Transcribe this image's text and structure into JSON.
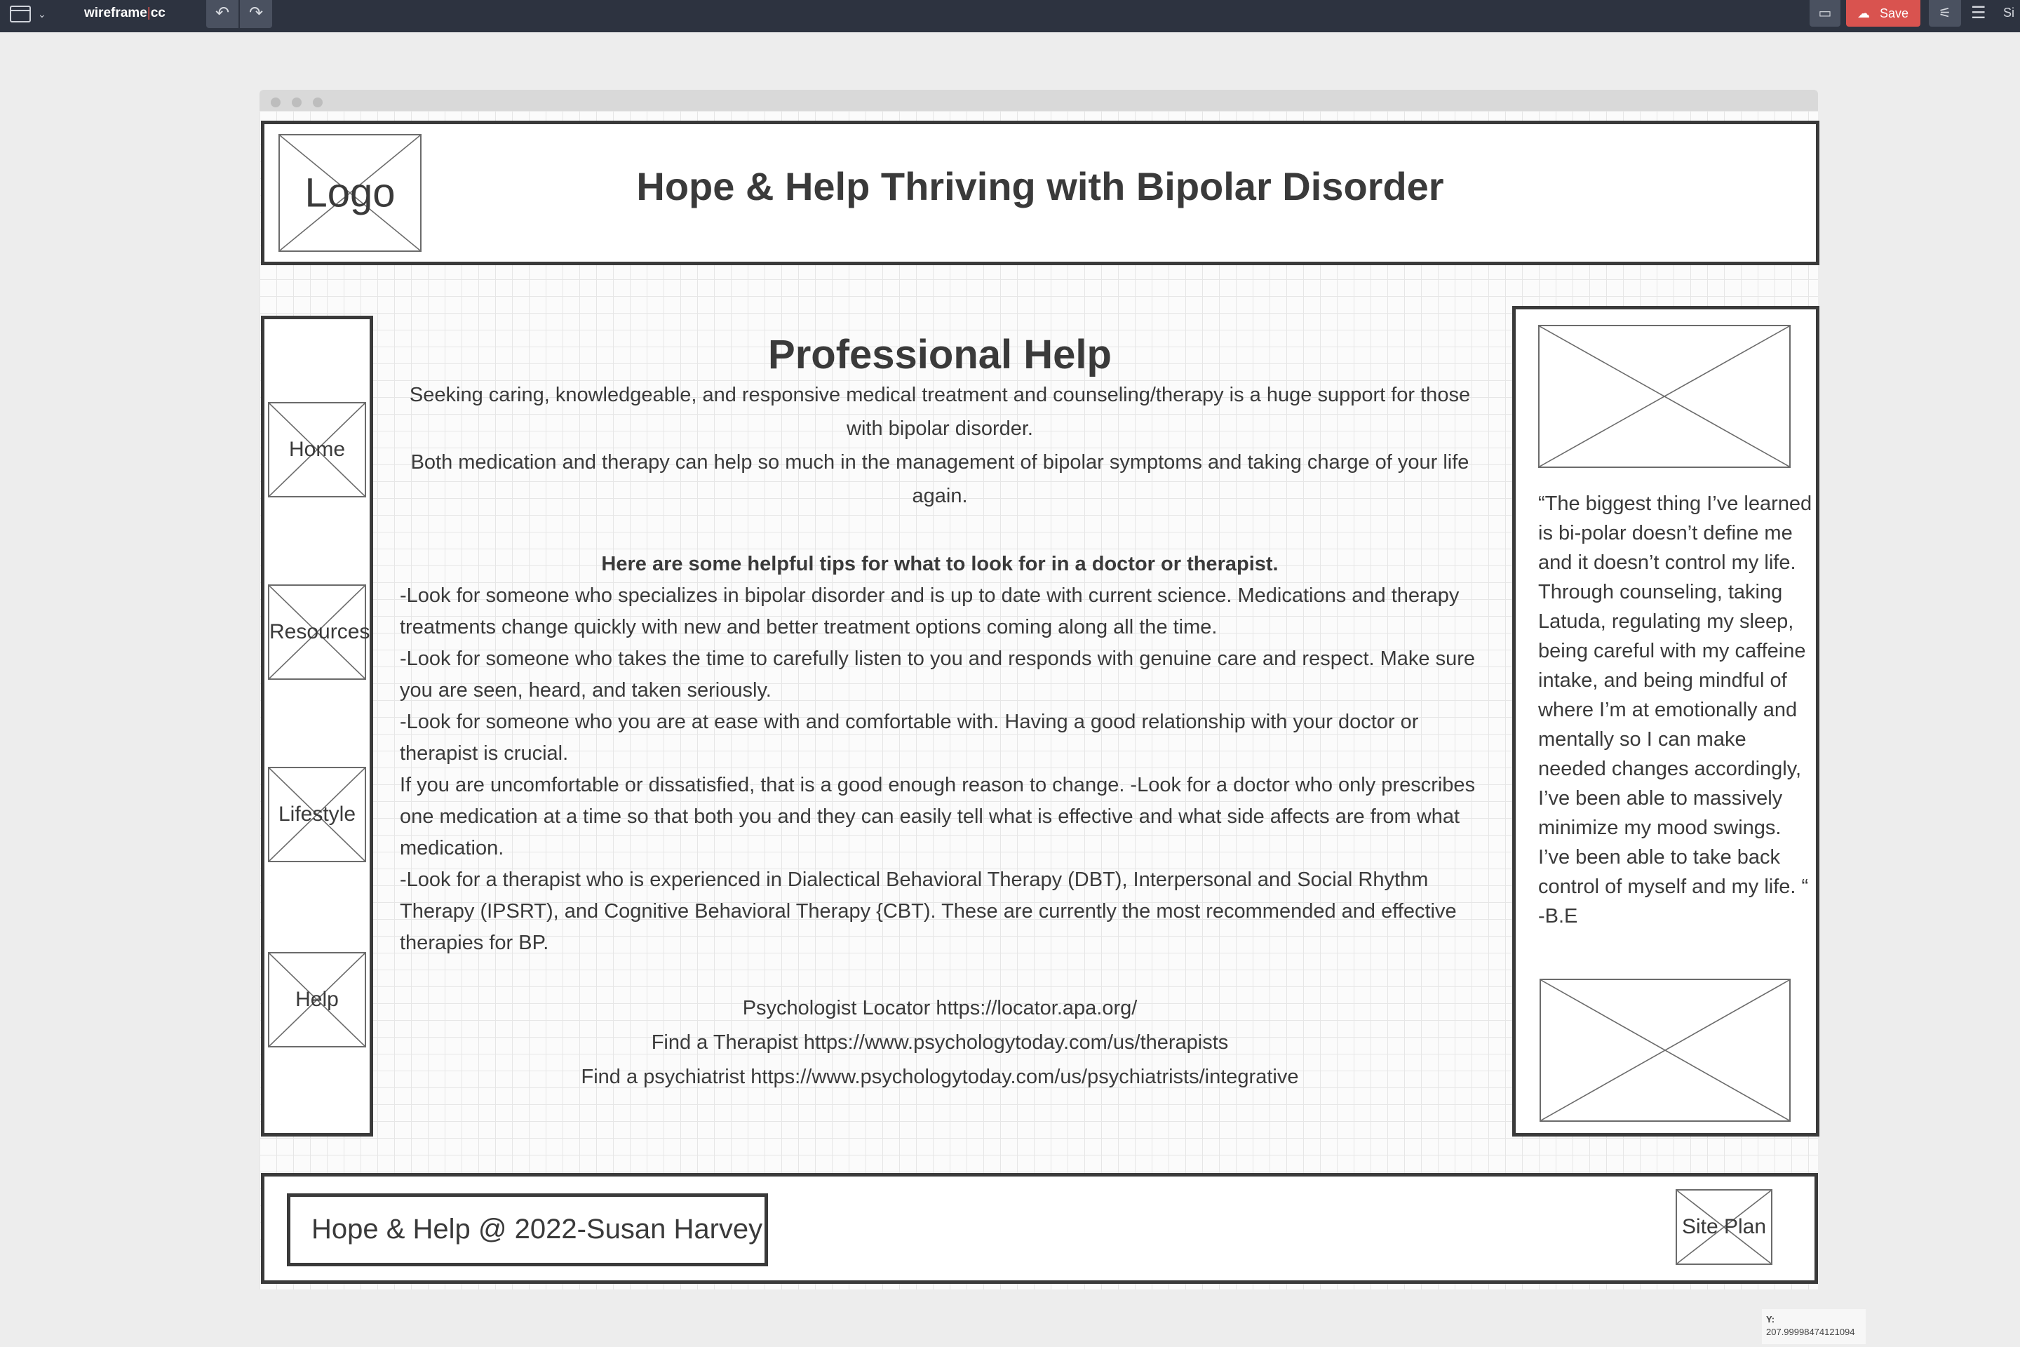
{
  "app": {
    "brand": "wireframe",
    "brand_suffix": "cc",
    "save_label": "Save",
    "side_label": "Si"
  },
  "site": {
    "logo": "Logo",
    "title": "Hope & Help Thriving with Bipolar Disorder"
  },
  "nav": [
    "Home",
    "Resources",
    "Lifestyle",
    "Help"
  ],
  "main": {
    "title": "Professional Help",
    "intro": [
      "Seeking caring, knowledgeable, and responsive medical treatment and counseling/therapy is a huge support for those with bipolar disorder.",
      "Both medication and therapy can help so much in the management of bipolar symptoms and taking charge of your life again."
    ],
    "tips_heading": "Here are some helpful tips for what to look for in a doctor or therapist.",
    "tips": [
      " -Look for someone who specializes in bipolar disorder and is up to date with current science. Medications and therapy treatments change quickly with new and better treatment options coming along all the time.",
      " -Look for someone who takes the time to carefully listen to you and responds with genuine care and respect. Make sure you are seen, heard, and taken seriously.",
      " -Look for someone who you are at ease with and comfortable with. Having a good relationship with your doctor or therapist is crucial.",
      "If you are uncomfortable or dissatisfied, that is a good enough reason to change. -Look for a doctor who only prescribes one medication at a time so that both you and they can easily tell what is effective and what side affects are from what medication.",
      " -Look for a therapist who is experienced in Dialectical Behavioral Therapy (DBT), Interpersonal and Social Rhythm Therapy (IPSRT), and Cognitive Behavioral Therapy {CBT). These are currently the most recommended and effective therapies for BP."
    ],
    "links": [
      "Psychologist Locator https://locator.apa.org/",
      "Find a Therapist https://www.psychologytoday.com/us/therapists",
      "Find a psychiatrist https://www.psychologytoday.com/us/psychiatrists/integrative"
    ]
  },
  "aside": {
    "quote": "“The biggest thing I’ve learned is bi-polar doesn’t define me and it doesn’t control my life. Through counseling, taking Latuda, regulating my sleep, being careful with my caffeine intake, and being mindful of where I’m at emotionally and mentally so I can make needed changes accordingly, I’ve been able to massively minimize my mood swings. I’ve been able to take back control of myself and my life. “ -B.E"
  },
  "footer": {
    "copyright": "Hope & Help @ 2022-Susan Harvey",
    "site_plan": "Site Plan"
  },
  "status": {
    "y_label": "Y:",
    "y_value": "207.99998474121094"
  }
}
